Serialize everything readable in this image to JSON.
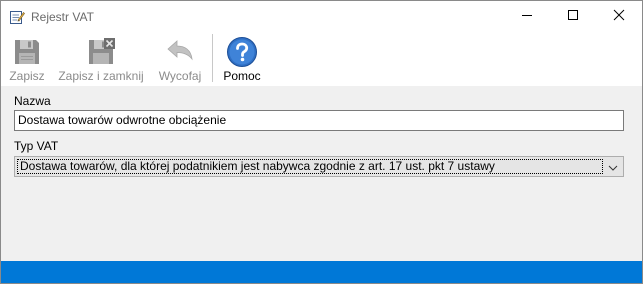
{
  "window": {
    "title": "Rejestr VAT",
    "app_icon": "notepad-pencil-icon",
    "controls": [
      "minimize-icon",
      "maximize-icon",
      "close-icon"
    ]
  },
  "toolbar": {
    "save_label": "Zapisz",
    "save_close_label": "Zapisz i zamknij",
    "undo_label": "Wycofaj",
    "help_label": "Pomoc",
    "icons": {
      "save": "floppy-disk-icon",
      "save_close": "floppy-disk-close-icon",
      "undo": "undo-arrow-icon",
      "help": "help-question-icon"
    }
  },
  "form": {
    "name_label": "Nazwa",
    "name_value": "Dostawa towarów odwrotne obciążenie",
    "vat_type_label": "Typ VAT",
    "vat_type_value": "Dostawa towarów, dla której podatnikiem jest nabywca zgodnie z art. 17 ust. pkt 7 ustawy"
  },
  "colors": {
    "status_bar": "#0078d7",
    "form_background": "#f0f0f0",
    "help_icon": "#2f6fc4"
  }
}
